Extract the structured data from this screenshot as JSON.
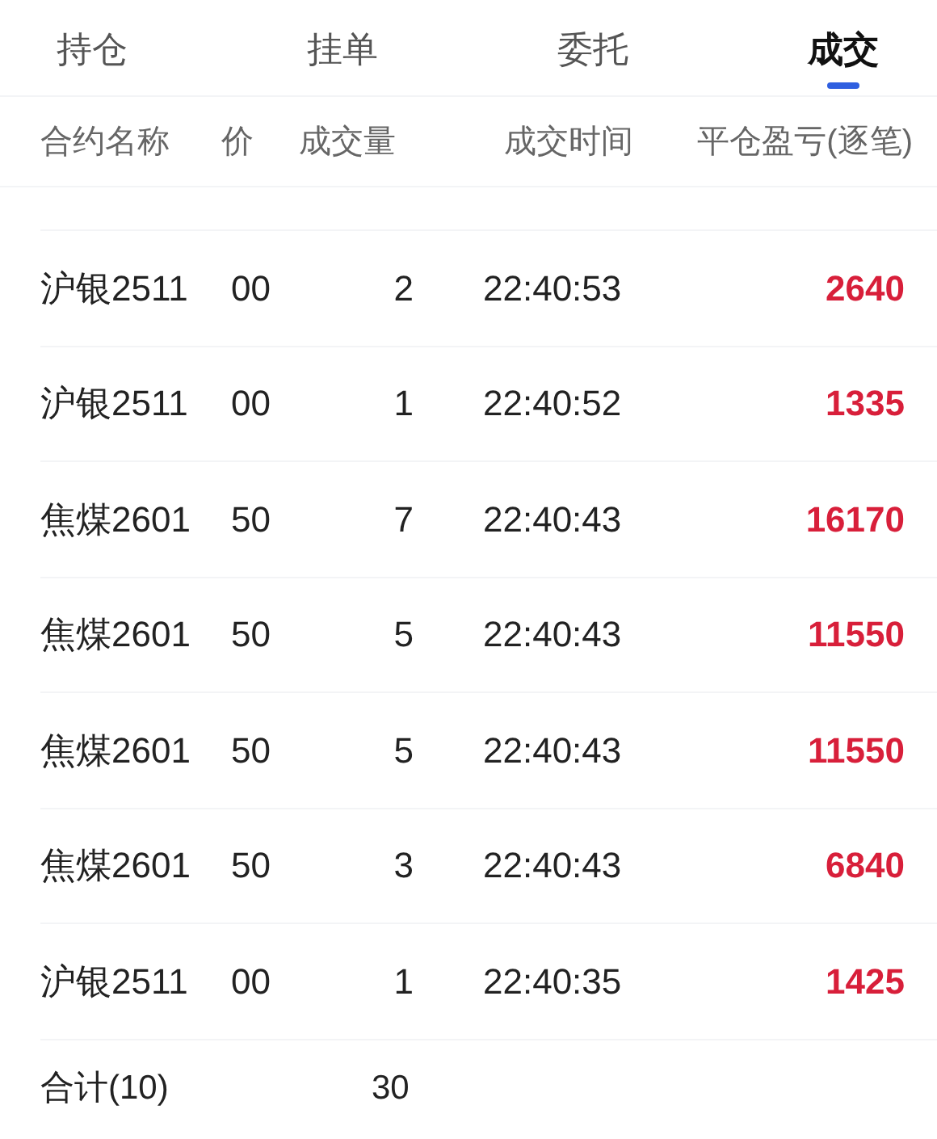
{
  "tabs": [
    {
      "label": "持仓",
      "selected": false
    },
    {
      "label": "挂单",
      "selected": false
    },
    {
      "label": "委托",
      "selected": false
    },
    {
      "label": "成交",
      "selected": true
    }
  ],
  "table": {
    "columns": [
      "合约名称",
      "价",
      "成交量",
      "成交时间",
      "平仓盈亏(逐笔)"
    ],
    "rows": [
      {
        "contract": "沪银2511",
        "price": "00",
        "volume": "2",
        "time": "22:40:53",
        "pnl": "2640"
      },
      {
        "contract": "沪银2511",
        "price": "00",
        "volume": "1",
        "time": "22:40:52",
        "pnl": "1335"
      },
      {
        "contract": "焦煤2601",
        "price": "50",
        "volume": "7",
        "time": "22:40:43",
        "pnl": "16170"
      },
      {
        "contract": "焦煤2601",
        "price": "50",
        "volume": "5",
        "time": "22:40:43",
        "pnl": "11550"
      },
      {
        "contract": "焦煤2601",
        "price": "50",
        "volume": "5",
        "time": "22:40:43",
        "pnl": "11550"
      },
      {
        "contract": "焦煤2601",
        "price": "50",
        "volume": "3",
        "time": "22:40:43",
        "pnl": "6840"
      },
      {
        "contract": "沪银2511",
        "price": "00",
        "volume": "1",
        "time": "22:40:35",
        "pnl": "1425"
      }
    ],
    "total": {
      "label": "合计(10)",
      "volume": "30"
    }
  }
}
